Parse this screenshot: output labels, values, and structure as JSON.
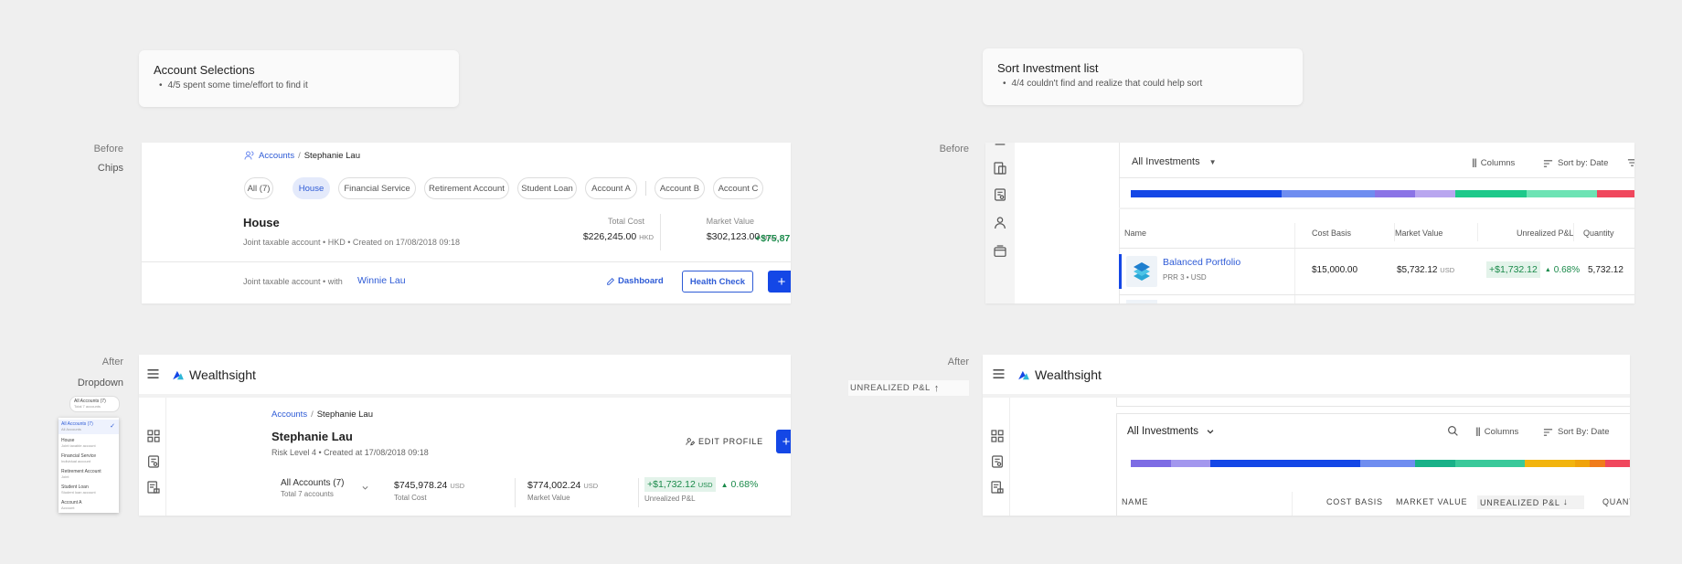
{
  "notes": {
    "left": {
      "title": "Account Selections",
      "bullet": "4/5 spent some time/effort to find it"
    },
    "right": {
      "title": "Sort Investment list",
      "bullet": "4/4 couldn't find and realize that could help sort"
    }
  },
  "labels": {
    "before_left": "Before",
    "chips": "Chips",
    "after_left": "After",
    "dropdown": "Dropdown",
    "before_right": "Before",
    "after_right": "After",
    "unrealized_floating": "UNREALIZED P&L"
  },
  "before_chips": {
    "breadcrumb_link": "Accounts",
    "breadcrumb_sep": "/",
    "breadcrumb_current": "Stephanie Lau",
    "chips": [
      "All (7)",
      "House",
      "Financial Service",
      "Retirement Account",
      "Student Loan",
      "Account A",
      "Account B",
      "Account C"
    ],
    "active_chip": "House",
    "account_title": "House",
    "account_meta": "Joint taxable account • HKD • Created on 17/08/2018 09:18",
    "total_cost_label": "Total Cost",
    "total_cost_value": "$226,245.00",
    "total_cost_unit": "HKD",
    "market_value_label": "Market Value",
    "market_value_value": "$302,123.00",
    "market_value_unit": "HKD",
    "pnl_partial": "+$75,87",
    "footer_text": "Joint taxable account • with",
    "footer_user": "Winnie Lau",
    "dashboard_label": "Dashboard",
    "health_check_label": "Health Check",
    "plus_label": "+"
  },
  "after_dropdown": {
    "brand": "Wealthsight",
    "breadcrumb_link": "Accounts",
    "breadcrumb_sep": "/",
    "breadcrumb_current": "Stephanie Lau",
    "title": "Stephanie Lau",
    "meta": "Risk Level 4 • Created at 17/08/2018 09:18",
    "edit_profile": "EDIT PROFILE",
    "plus_label": "+",
    "select_value": "All Accounts (7)",
    "select_sub": "Total 7 accounts",
    "total_cost_value": "$745,978.24",
    "total_cost_unit": "USD",
    "total_cost_label": "Total Cost",
    "market_value_value": "$774,002.24",
    "market_value_unit": "USD",
    "market_value_label": "Market Value",
    "pnl_value": "+$1,732.12",
    "pnl_unit": "USD",
    "pnl_pct": "0.68%",
    "pnl_label": "Unrealized P&L",
    "mini_dropdown": {
      "selected": "All Accounts (7)",
      "selected_sub": "Total 7 accounts",
      "items": [
        {
          "label": "All Accounts (7)",
          "sub": "All Accounts"
        },
        {
          "label": "House",
          "sub": "Joint taxable account"
        },
        {
          "label": "Financial Service",
          "sub": "Individual account"
        },
        {
          "label": "Retirement Account",
          "sub": "Joint"
        },
        {
          "label": "Student Loan",
          "sub": "Student loan account"
        },
        {
          "label": "Account A",
          "sub": "Account"
        }
      ]
    }
  },
  "before_sort": {
    "dropdown_label": "All Investments",
    "columns_label": "Columns",
    "sort_label": "Sort by: Date",
    "headers": [
      "Name",
      "Cost Basis",
      "Market Value",
      "Unrealized P&L",
      "Quantity"
    ],
    "row": {
      "name": "Balanced Portfolio",
      "sub": "PRR 3 • USD",
      "cost_basis": "$15,000.00",
      "market_value": "$5,732.12",
      "market_value_unit": "USD",
      "pnl": "+$1,732.12",
      "pnl_pct": "0.68%",
      "quantity": "5,732.12"
    },
    "bar_colors": [
      "#1447e6",
      "#6f8df0",
      "#8b74e6",
      "#b9a6ef",
      "#1ec98a",
      "#6de3b4",
      "#f0475d",
      "#f4a0a8"
    ],
    "bar_fractions": [
      0.3,
      0.185,
      0.08,
      0.08,
      0.14,
      0.14,
      0.14,
      0.11
    ]
  },
  "after_sort": {
    "brand": "Wealthsight",
    "dropdown_label": "All Investments",
    "columns_label": "Columns",
    "sort_label": "Sort By: Date",
    "headers": [
      "NAME",
      "COST BASIS",
      "MARKET VALUE",
      "UNREALIZED P&L",
      "QUANT"
    ],
    "bar_colors": [
      "#7d6ce4",
      "#a397ee",
      "#1447e6",
      "#6f8df0",
      "#19b188",
      "#3ac99a",
      "#f2b40e",
      "#f0a30b",
      "#f07c1b",
      "#f0475d"
    ],
    "bar_fractions": [
      0.08,
      0.08,
      0.3,
      0.11,
      0.08,
      0.14,
      0.1,
      0.03,
      0.03,
      0.05
    ]
  }
}
